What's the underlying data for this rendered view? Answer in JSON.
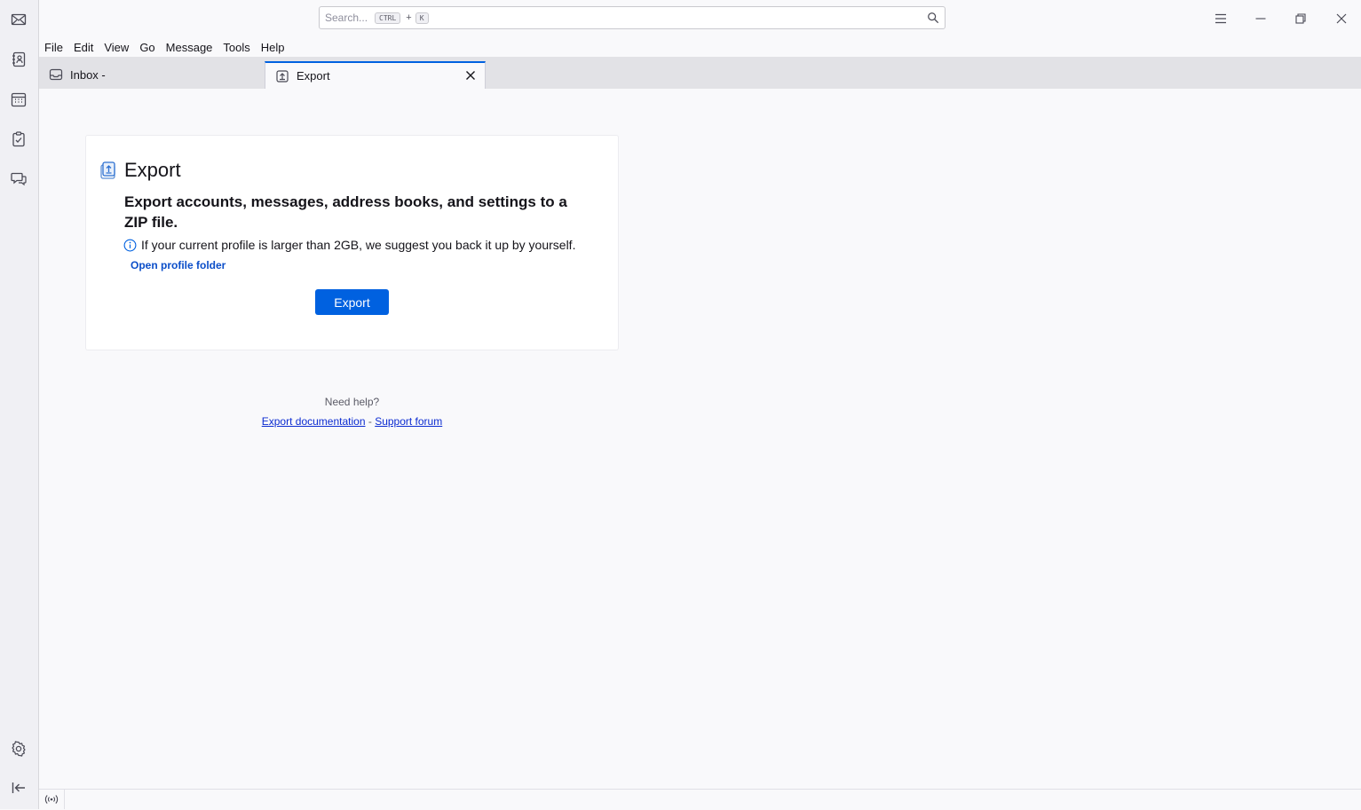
{
  "search": {
    "placeholder": "Search...",
    "shortcut_key1": "CTRL",
    "shortcut_plus": "+",
    "shortcut_key2": "K"
  },
  "menubar": {
    "items": [
      "File",
      "Edit",
      "View",
      "Go",
      "Message",
      "Tools",
      "Help"
    ]
  },
  "tabs": [
    {
      "label": "Inbox -",
      "icon": "inbox-icon",
      "active": false
    },
    {
      "label": "Export",
      "icon": "export-tab-icon",
      "active": true
    }
  ],
  "export_card": {
    "title": "Export",
    "description": "Export accounts, messages, address books, and settings to a ZIP file.",
    "info_text": "If your current profile is larger than 2GB, we suggest you back it up by yourself.",
    "open_folder_link": "Open profile folder",
    "export_button": "Export"
  },
  "help": {
    "heading": "Need help?",
    "doc_link": "Export documentation",
    "separator": "-",
    "forum_link": "Support forum"
  },
  "colors": {
    "accent": "#0061e0",
    "link": "#0b2bd1"
  }
}
